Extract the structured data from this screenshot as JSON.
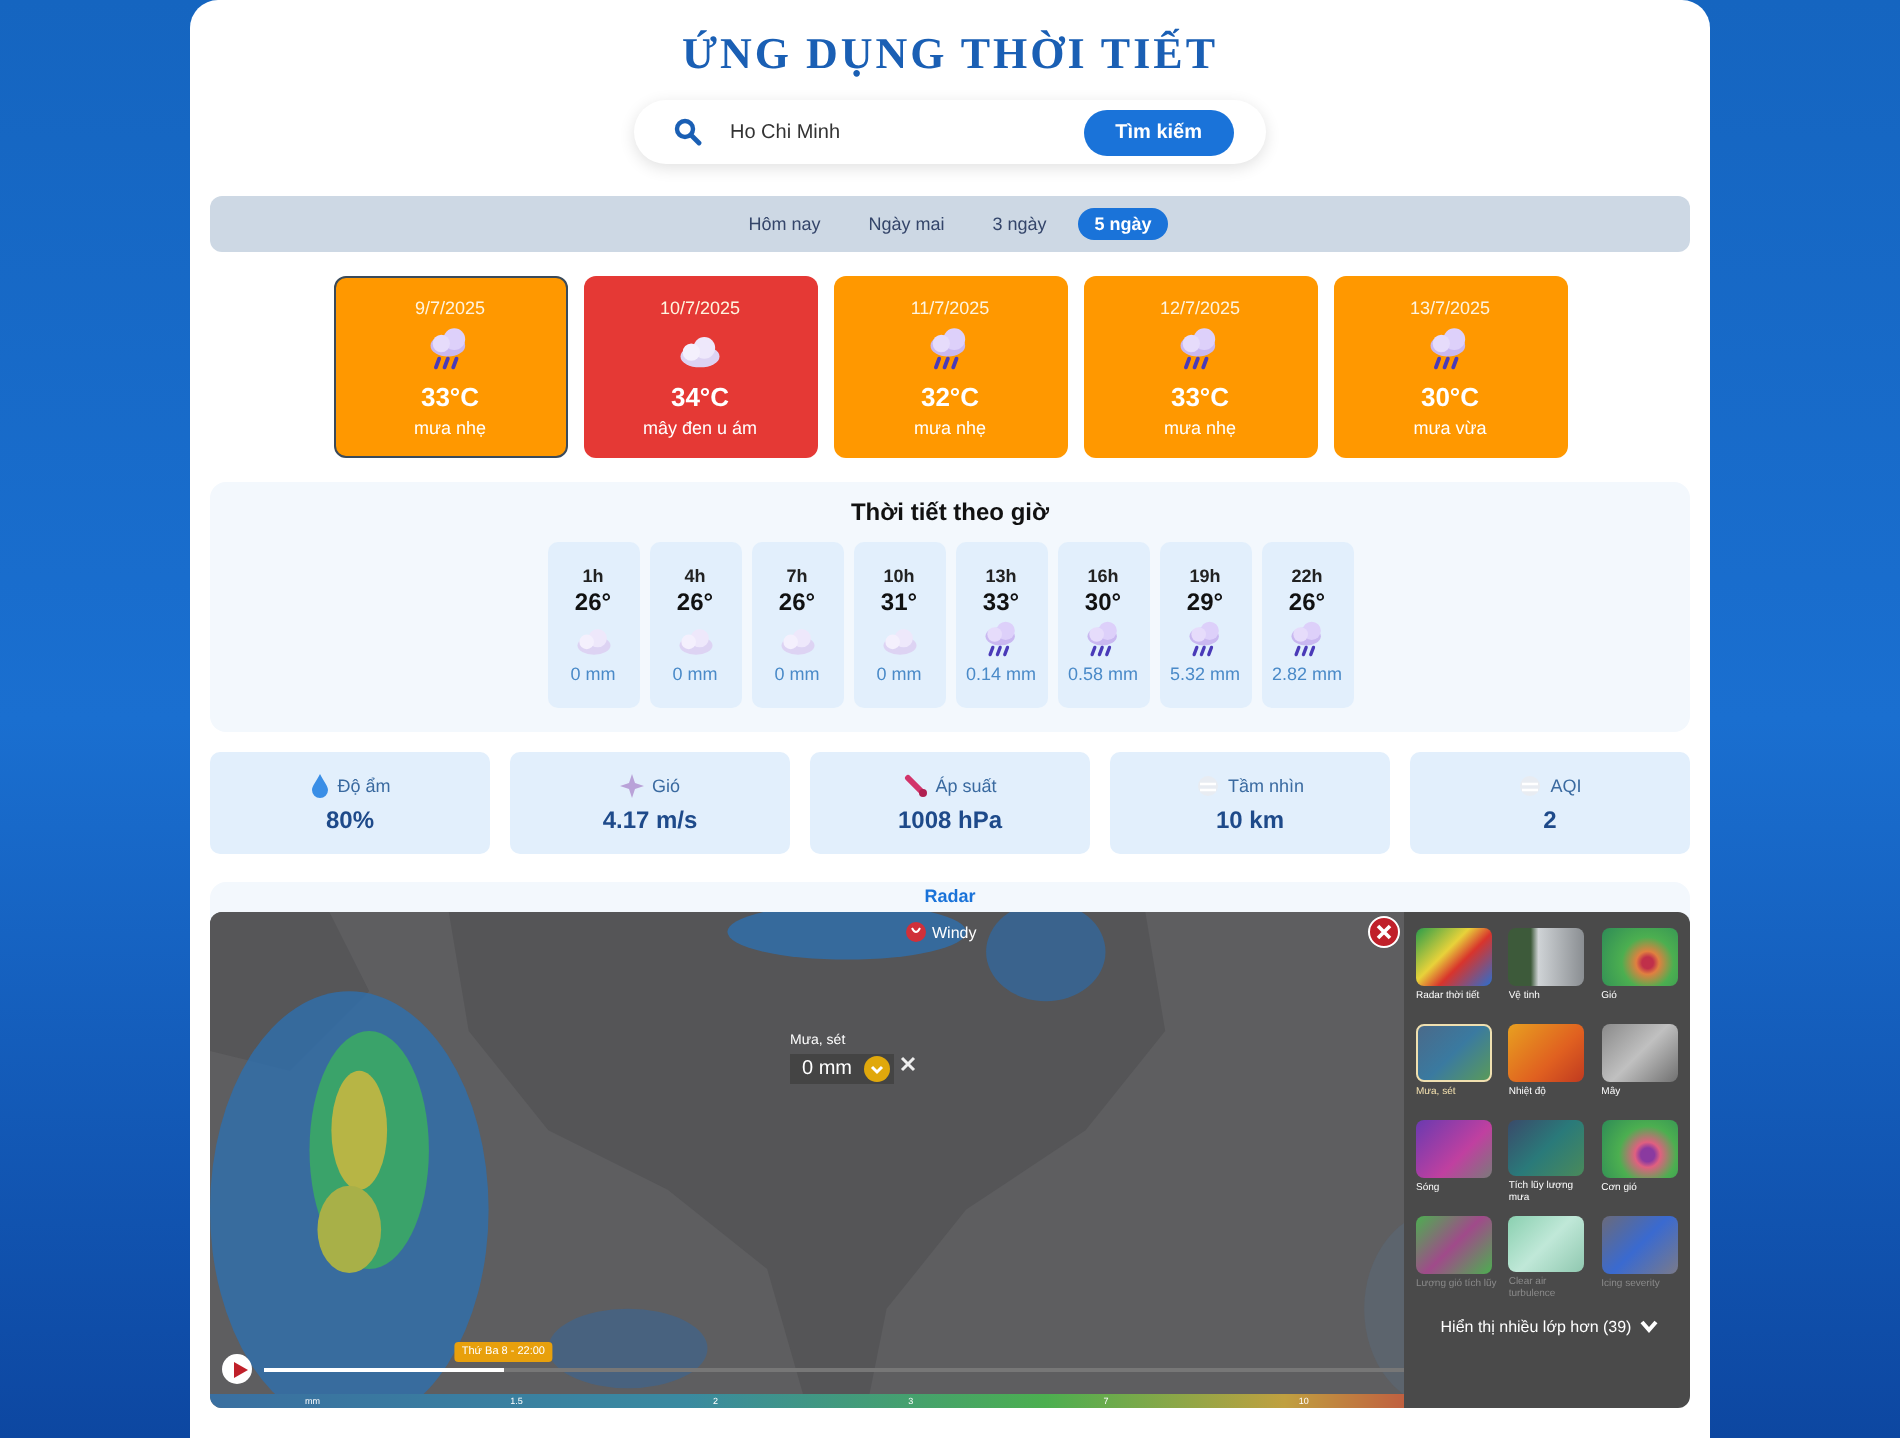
{
  "title": "ỨNG DỤNG THỜI TIẾT",
  "search": {
    "value": "Ho Chi Minh",
    "button": "Tìm kiếm"
  },
  "tabs": [
    {
      "label": "Hôm nay",
      "selected": false
    },
    {
      "label": "Ngày mai",
      "selected": false
    },
    {
      "label": "3 ngày",
      "selected": false
    },
    {
      "label": "5 ngày",
      "selected": true
    }
  ],
  "days": [
    {
      "date": "9/7/2025",
      "temp": "33°C",
      "desc": "mưa nhẹ",
      "kind": "rain",
      "color": "#ff9800",
      "selected": true
    },
    {
      "date": "10/7/2025",
      "temp": "34°C",
      "desc": "mây đen u ám",
      "kind": "cloud",
      "color": "#e53935",
      "selected": false
    },
    {
      "date": "11/7/2025",
      "temp": "32°C",
      "desc": "mưa nhẹ",
      "kind": "rain",
      "color": "#ff9800",
      "selected": false
    },
    {
      "date": "12/7/2025",
      "temp": "33°C",
      "desc": "mưa nhẹ",
      "kind": "rain",
      "color": "#ff9800",
      "selected": false
    },
    {
      "date": "13/7/2025",
      "temp": "30°C",
      "desc": "mưa vừa",
      "kind": "rain",
      "color": "#ff9800",
      "selected": false
    }
  ],
  "hourly": {
    "title": "Thời tiết theo giờ",
    "hours": [
      {
        "time": "1h",
        "temp": "26°",
        "kind": "cloud",
        "rain": "0 mm"
      },
      {
        "time": "4h",
        "temp": "26°",
        "kind": "cloud",
        "rain": "0 mm"
      },
      {
        "time": "7h",
        "temp": "26°",
        "kind": "cloud",
        "rain": "0 mm"
      },
      {
        "time": "10h",
        "temp": "31°",
        "kind": "cloud",
        "rain": "0 mm"
      },
      {
        "time": "13h",
        "temp": "33°",
        "kind": "rain",
        "rain": "0.14 mm"
      },
      {
        "time": "16h",
        "temp": "30°",
        "kind": "rain",
        "rain": "0.58 mm"
      },
      {
        "time": "19h",
        "temp": "29°",
        "kind": "rain",
        "rain": "5.32 mm"
      },
      {
        "time": "22h",
        "temp": "26°",
        "kind": "rain",
        "rain": "2.82 mm"
      }
    ]
  },
  "stats": [
    {
      "kind": "humidity",
      "label": "Độ ẩm",
      "value": "80%"
    },
    {
      "kind": "wind",
      "label": "Gió",
      "value": "4.17 m/s"
    },
    {
      "kind": "pressure",
      "label": "Áp suất",
      "value": "1008 hPa"
    },
    {
      "kind": "visibility",
      "label": "Tầm nhìn",
      "value": "10 km"
    },
    {
      "kind": "aqui",
      "label": "AQI",
      "value": "2"
    }
  ],
  "radar": {
    "title": "Radar",
    "brand": "Windy",
    "picker": {
      "label": "Mưa, sét",
      "value": "0 mm"
    },
    "timeline": {
      "label": "Thứ Ba 8 - 22:00",
      "level": 0.21
    },
    "legend": [
      "mm",
      "1.5",
      "2",
      "3",
      "7",
      "10"
    ],
    "layers": [
      {
        "label": "Radar thời tiết",
        "kind": "radar",
        "selected": false,
        "disabled": false
      },
      {
        "label": "Vệ tinh",
        "kind": "satellite",
        "selected": false,
        "disabled": false
      },
      {
        "label": "Gió",
        "kind": "wind",
        "selected": false,
        "disabled": false
      },
      {
        "label": "Mưa, sét",
        "kind": "rain",
        "selected": true,
        "disabled": false
      },
      {
        "label": "Nhiệt độ",
        "kind": "temp",
        "selected": false,
        "disabled": false
      },
      {
        "label": "Mây",
        "kind": "cloud",
        "selected": false,
        "disabled": false
      },
      {
        "label": "Sóng",
        "kind": "waves",
        "selected": false,
        "disabled": false
      },
      {
        "label": "Tích lũy lượng mưa",
        "kind": "accum",
        "selected": false,
        "disabled": false
      },
      {
        "label": "Cơn gió",
        "kind": "gust",
        "selected": false,
        "disabled": false
      },
      {
        "label": "Lượng gió tích lũy",
        "kind": "gustaccu",
        "selected": false,
        "disabled": true
      },
      {
        "label": "Clear air turbulence",
        "kind": "cat",
        "selected": false,
        "disabled": true
      },
      {
        "label": "Icing severity",
        "kind": "icing",
        "selected": false,
        "disabled": true
      }
    ],
    "more_layers": "Hiển thị nhiều lớp hơn (39)"
  }
}
